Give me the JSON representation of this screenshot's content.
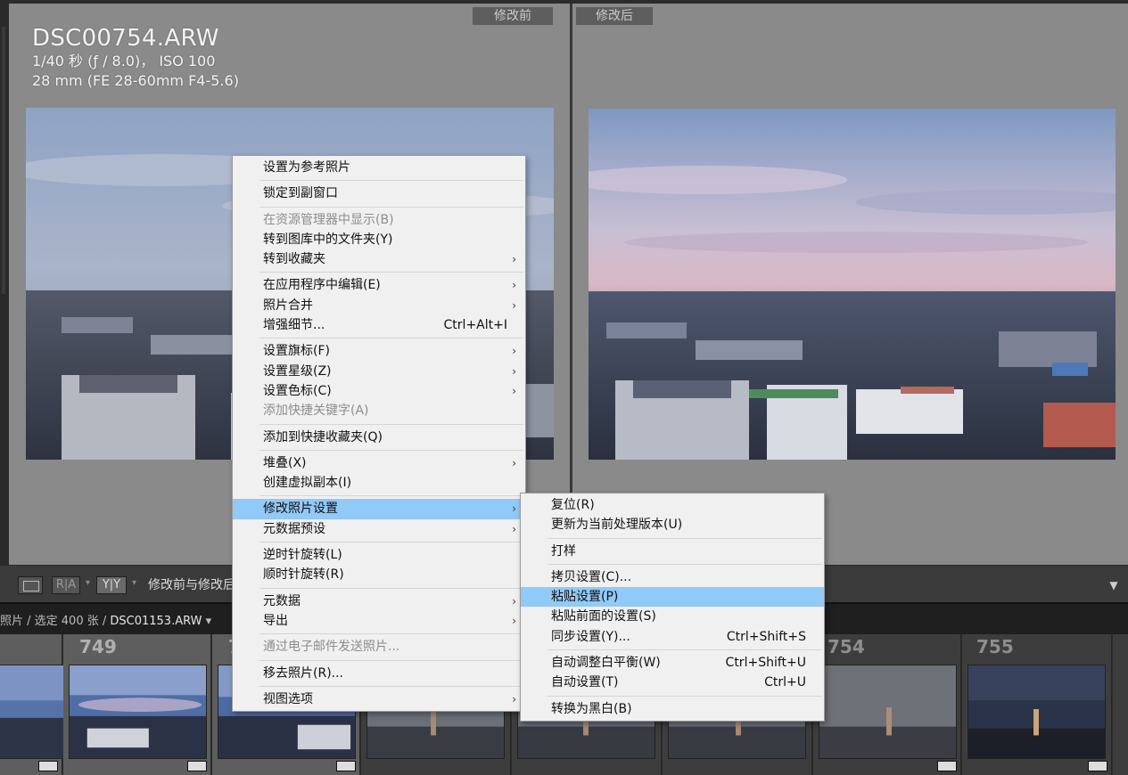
{
  "before_view": {
    "tag": "修改前",
    "file_name": "DSC00754.ARW",
    "exposure_line": "1/40 秒 (ƒ / 8.0)， ISO 100",
    "lens_line": "28 mm (FE 28-60mm F4-5.6)"
  },
  "after_view": {
    "tag": "修改后"
  },
  "toolbar": {
    "single_view_icon": "single-view-icon",
    "ra_label": "R|A",
    "yy_label": "Y|Y",
    "mode_label": "修改前与修改后"
  },
  "filmstrip_header": {
    "path_prefix": "照片 / 选定 400 张 / ",
    "current_file": "DSC01153.ARW",
    "caret": "▾"
  },
  "filmstrip": {
    "cells": [
      {
        "num": "",
        "selected": true
      },
      {
        "num": "749",
        "selected": true
      },
      {
        "num": "7",
        "selected": true
      },
      {
        "num": "",
        "selected": false
      },
      {
        "num": "",
        "selected": false
      },
      {
        "num": "",
        "selected": false
      },
      {
        "num": "754",
        "selected": false
      },
      {
        "num": "755",
        "selected": false
      }
    ]
  },
  "context_menu": {
    "items": [
      {
        "label": "设置为参考照片"
      },
      {
        "sep": true
      },
      {
        "label": "锁定到副窗口"
      },
      {
        "sep": true
      },
      {
        "label": "在资源管理器中显示(B)",
        "disabled": true
      },
      {
        "label": "转到图库中的文件夹(Y)"
      },
      {
        "label": "转到收藏夹",
        "submenu": true
      },
      {
        "sep": true
      },
      {
        "label": "在应用程序中编辑(E)",
        "submenu": true
      },
      {
        "label": "照片合并",
        "submenu": true
      },
      {
        "label": "增强细节...",
        "shortcut": "Ctrl+Alt+I"
      },
      {
        "sep": true
      },
      {
        "label": "设置旗标(F)",
        "submenu": true
      },
      {
        "label": "设置星级(Z)",
        "submenu": true
      },
      {
        "label": "设置色标(C)",
        "submenu": true
      },
      {
        "label": "添加快捷关键字(A)",
        "disabled": true
      },
      {
        "sep": true
      },
      {
        "label": "添加到快捷收藏夹(Q)"
      },
      {
        "sep": true
      },
      {
        "label": "堆叠(X)",
        "submenu": true
      },
      {
        "label": "创建虚拟副本(I)"
      },
      {
        "sep": true
      },
      {
        "label": "修改照片设置",
        "submenu": true,
        "highlighted": true
      },
      {
        "label": "元数据预设",
        "submenu": true
      },
      {
        "sep": true
      },
      {
        "label": "逆时针旋转(L)"
      },
      {
        "label": "顺时针旋转(R)"
      },
      {
        "sep": true
      },
      {
        "label": "元数据",
        "submenu": true
      },
      {
        "label": "导出",
        "submenu": true
      },
      {
        "sep": true
      },
      {
        "label": "通过电子邮件发送照片...",
        "disabled": true
      },
      {
        "sep": true
      },
      {
        "label": "移去照片(R)..."
      },
      {
        "sep": true
      },
      {
        "label": "视图选项",
        "submenu": true
      }
    ],
    "arrow_glyph": "›"
  },
  "develop_submenu": {
    "items": [
      {
        "label": "复位(R)"
      },
      {
        "label": "更新为当前处理版本(U)"
      },
      {
        "sep": true
      },
      {
        "label": "打样"
      },
      {
        "sep": true
      },
      {
        "label": "拷贝设置(C)..."
      },
      {
        "label": "粘贴设置(P)",
        "highlighted": true
      },
      {
        "label": "粘贴前面的设置(S)"
      },
      {
        "label": "同步设置(Y)...",
        "shortcut": "Ctrl+Shift+S"
      },
      {
        "sep": true
      },
      {
        "label": "自动调整白平衡(W)",
        "shortcut": "Ctrl+Shift+U"
      },
      {
        "label": "自动设置(T)",
        "shortcut": "Ctrl+U"
      },
      {
        "sep": true
      },
      {
        "label": "转换为黑白(B)"
      }
    ]
  },
  "colors": {
    "menu_highlight": "#91c9f7",
    "pane_background": "#8a8a8a",
    "app_background": "#3c3c3c"
  }
}
